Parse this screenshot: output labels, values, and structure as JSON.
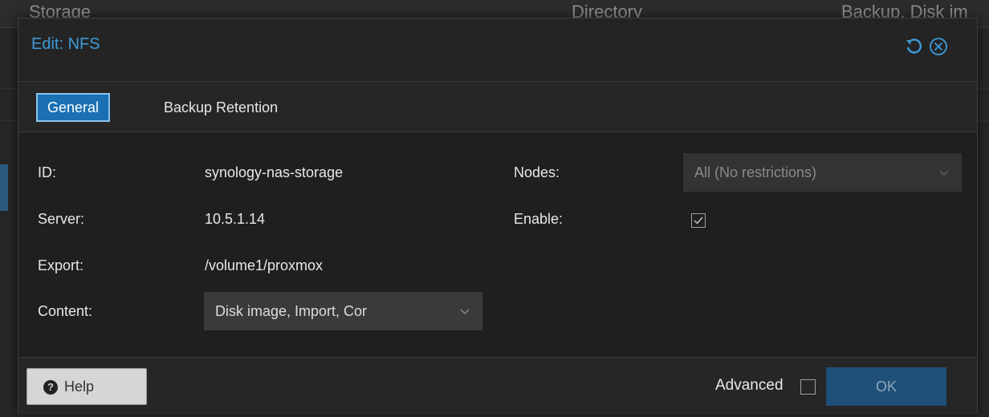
{
  "background": {
    "headers": [
      "Storage",
      "Directory",
      "Backup, Disk im"
    ]
  },
  "dialog": {
    "title": "Edit: NFS",
    "tabs": [
      {
        "label": "General",
        "active": true
      },
      {
        "label": "Backup Retention",
        "active": false
      }
    ],
    "fields": {
      "id": {
        "label": "ID:",
        "value": "synology-nas-storage"
      },
      "server": {
        "label": "Server:",
        "value": "10.5.1.14"
      },
      "export": {
        "label": "Export:",
        "value": "/volume1/proxmox"
      },
      "content": {
        "label": "Content:",
        "value": "Disk image, Import, Cor"
      },
      "nodes": {
        "label": "Nodes:",
        "value": "All (No restrictions)",
        "disabled": true
      },
      "enable": {
        "label": "Enable:",
        "checked": true
      }
    },
    "footer": {
      "help_label": "Help",
      "advanced_label": "Advanced",
      "advanced_checked": false,
      "ok_label": "OK"
    }
  },
  "colors": {
    "accent": "#3d9bd9",
    "tab_active_bg": "#1a70b3",
    "ok_bg": "#1e4f78"
  },
  "icons": {
    "reset": "reset-icon",
    "close": "close-icon",
    "help": "help-icon",
    "chevron": "chevron-down-icon"
  }
}
